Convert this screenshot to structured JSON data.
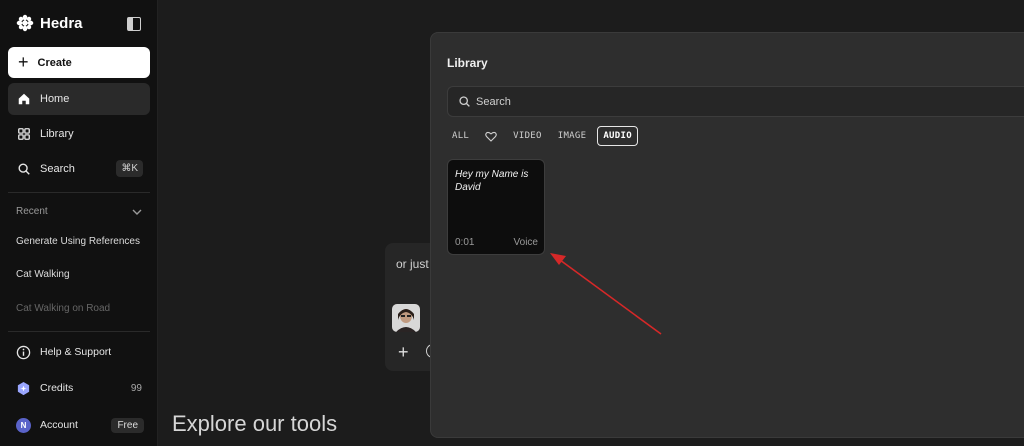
{
  "brand": {
    "name": "Hedra"
  },
  "sidebar": {
    "create_label": "Create",
    "nav": [
      {
        "label": "Home"
      },
      {
        "label": "Library"
      },
      {
        "label": "Search",
        "shortcut": "⌘K"
      }
    ],
    "recent": {
      "heading": "Recent",
      "items": [
        {
          "label": "Generate Using References"
        },
        {
          "label": "Cat Walking"
        },
        {
          "label": "Cat Walking on Road"
        }
      ]
    },
    "bottom": {
      "help": "Help & Support",
      "credits": "Credits",
      "credits_value": "99",
      "account": "Account",
      "account_initial": "N",
      "plan": "Free"
    }
  },
  "main": {
    "explore_title": "Explore our tools",
    "behind_text": "or just"
  },
  "library": {
    "title": "Library",
    "search_placeholder": "Search",
    "filters": {
      "all": "ALL",
      "video": "VIDEO",
      "image": "IMAGE",
      "audio": "AUDIO"
    },
    "active_filter": "AUDIO",
    "items": [
      {
        "title": "Hey my Name is David",
        "duration": "0:01",
        "kind": "Voice"
      }
    ]
  },
  "colors": {
    "annotation_arrow": "#d62828",
    "accent_avatar": "#5a63c9"
  }
}
